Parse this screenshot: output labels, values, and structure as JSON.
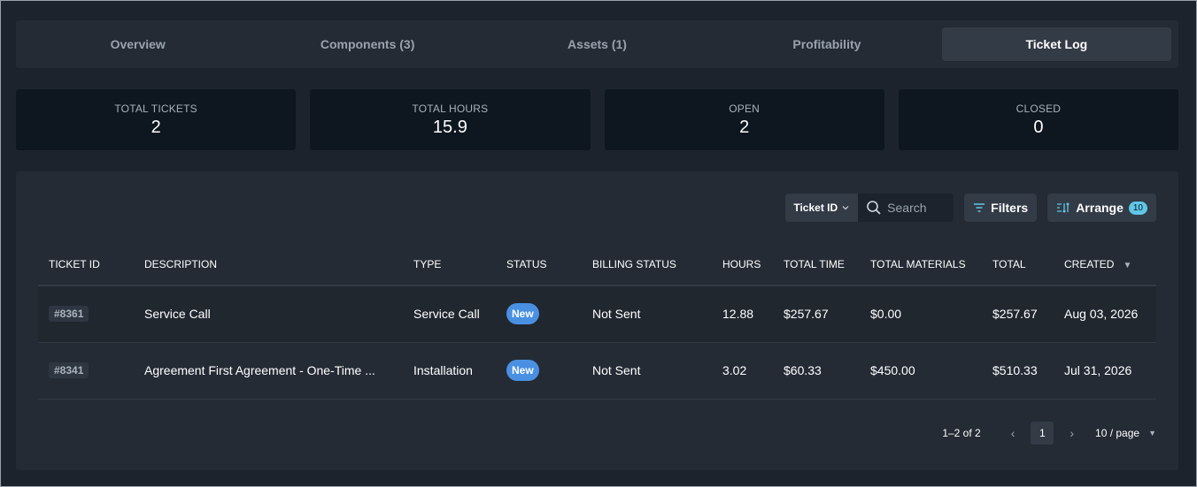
{
  "tabs": [
    {
      "label": "Overview",
      "active": false
    },
    {
      "label": "Components (3)",
      "active": false
    },
    {
      "label": "Assets (1)",
      "active": false
    },
    {
      "label": "Profitability",
      "active": false
    },
    {
      "label": "Ticket Log",
      "active": true
    }
  ],
  "stats": [
    {
      "label": "TOTAL TICKETS",
      "value": "2"
    },
    {
      "label": "TOTAL HOURS",
      "value": "15.9"
    },
    {
      "label": "OPEN",
      "value": "2"
    },
    {
      "label": "CLOSED",
      "value": "0"
    }
  ],
  "toolbar": {
    "search_field": "Ticket ID",
    "search_placeholder": "Search",
    "filters_label": "Filters",
    "arrange_label": "Arrange",
    "arrange_count": "10"
  },
  "table": {
    "columns": [
      "TICKET ID",
      "DESCRIPTION",
      "TYPE",
      "STATUS",
      "BILLING STATUS",
      "HOURS",
      "TOTAL TIME",
      "TOTAL MATERIALS",
      "TOTAL",
      "CREATED"
    ],
    "rows": [
      {
        "ticket_id": "#8361",
        "description": "Service Call",
        "type": "Service Call",
        "status": "New",
        "billing_status": "Not Sent",
        "hours": "12.88",
        "total_time": "$257.67",
        "total_materials": "$0.00",
        "total": "$257.67",
        "created": "Aug 03, 2026"
      },
      {
        "ticket_id": "#8341",
        "description": "Agreement First Agreement - One-Time ...",
        "type": "Installation",
        "status": "New",
        "billing_status": "Not Sent",
        "hours": "3.02",
        "total_time": "$60.33",
        "total_materials": "$450.00",
        "total": "$510.33",
        "created": "Jul 31, 2026"
      }
    ]
  },
  "pagination": {
    "range": "1–2 of 2",
    "current_page": "1",
    "page_size": "10 / page"
  },
  "colors": {
    "background": "#1c232d",
    "panel": "#242b35",
    "stat_card": "#0e1620",
    "status_new": "#4a90e2",
    "accent": "#5fc7e8"
  }
}
